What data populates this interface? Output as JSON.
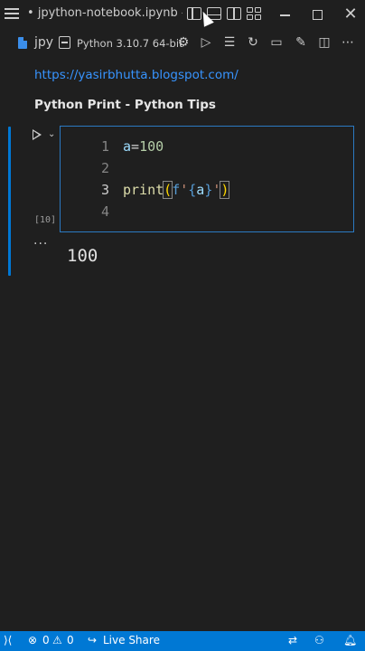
{
  "window": {
    "title": "jpython-notebook.ipynb - py..."
  },
  "toolbar": {
    "tab_name": "jpy",
    "kernel_label": "Python 3.10.7 64-bit"
  },
  "notebook": {
    "link": "https://yasirbhutta.blogspot.com/",
    "heading": "Python Print - Python Tips",
    "code_cell": {
      "execution_count": "[10]",
      "line_numbers": [
        "1",
        "2",
        "3",
        "4"
      ],
      "output": "100"
    }
  },
  "statusbar": {
    "errors": "0",
    "warnings": "0",
    "live_share": "Live Share"
  },
  "colors": {
    "accent": "#0078d4",
    "link": "#3794ff",
    "background": "#1f1f1f"
  }
}
